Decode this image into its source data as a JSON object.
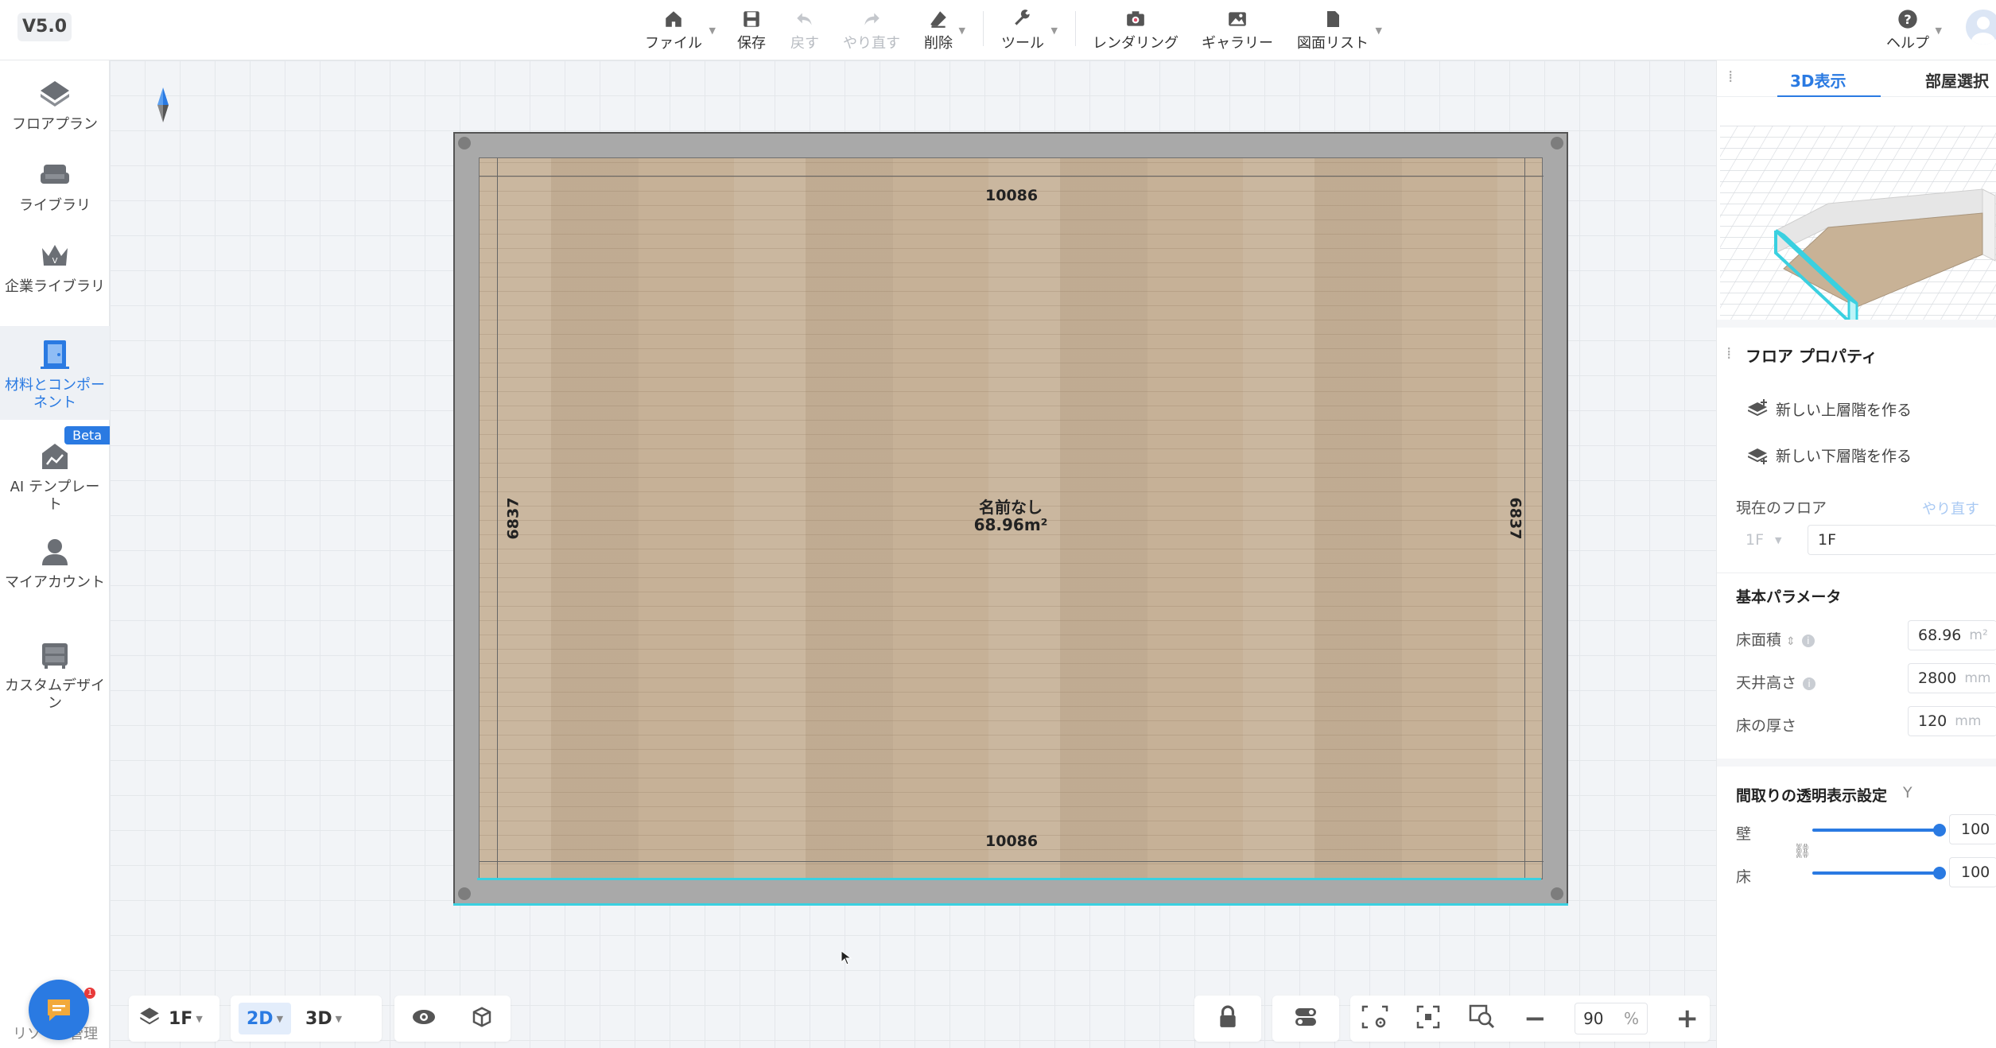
{
  "version": "V5.0",
  "toolbar": {
    "file": "ファイル",
    "save": "保存",
    "undo": "戻す",
    "redo": "やり直す",
    "delete": "削除",
    "tools": "ツール",
    "rendering": "レンダリング",
    "gallery": "ギャラリー",
    "drawing_list": "図面リスト",
    "help": "ヘルプ"
  },
  "sidebar": {
    "items": [
      {
        "label": "フロアプラン",
        "icon": "floorplan-icon"
      },
      {
        "label": "ライブラリ",
        "icon": "sofa-icon"
      },
      {
        "label": "企業ライブラリ",
        "icon": "crown-icon"
      },
      {
        "label": "材料とコンポーネント",
        "icon": "door-icon"
      },
      {
        "label": "AI テンプレート",
        "icon": "ai-template-icon"
      },
      {
        "label": "マイアカウント",
        "icon": "user-icon"
      },
      {
        "label": "カスタムデザイン",
        "icon": "cabinet-icon"
      }
    ],
    "beta_badge": "Beta",
    "bottom_text": "リソース管理"
  },
  "canvas": {
    "dim_top": "10086",
    "dim_bottom": "10086",
    "dim_left": "6837",
    "dim_right": "6837",
    "room_name": "名前なし",
    "room_area": "68.96m²"
  },
  "bottom_bar": {
    "floor": "1F",
    "view_2d": "2D",
    "view_3d": "3D",
    "zoom": "90",
    "zoom_unit": "%"
  },
  "right_panel": {
    "tab_3d": "3D表示",
    "tab_room": "部屋選択",
    "floor_props_title": "フロア プロパティ",
    "new_upper_floor": "新しい上層階を作る",
    "new_lower_floor": "新しい下層階を作る",
    "current_floor_label": "現在のフロア",
    "redo_link": "やり直す",
    "current_floor_select": "1F",
    "current_floor_value": "1F",
    "basic_params_title": "基本パラメータ",
    "floor_area_label": "床面積",
    "floor_area_value": "68.96",
    "floor_area_unit": "m²",
    "ceiling_height_label": "天井高さ",
    "ceiling_height_value": "2800",
    "ceiling_height_unit": "mm",
    "floor_thickness_label": "床の厚さ",
    "floor_thickness_value": "120",
    "floor_thickness_unit": "mm",
    "transparency_title": "間取りの透明表示設定",
    "transparency_toggle": "Y",
    "wall_label": "壁",
    "wall_value": "100",
    "floor_label": "床",
    "floor_value": "100",
    "wall_level": 1.0,
    "floor_level": 1.0
  },
  "colors": {
    "accent": "#2a7ae2",
    "selection": "#3ad0e0",
    "wall": "#a9a9a9",
    "floor_wood": "#c6b197"
  }
}
